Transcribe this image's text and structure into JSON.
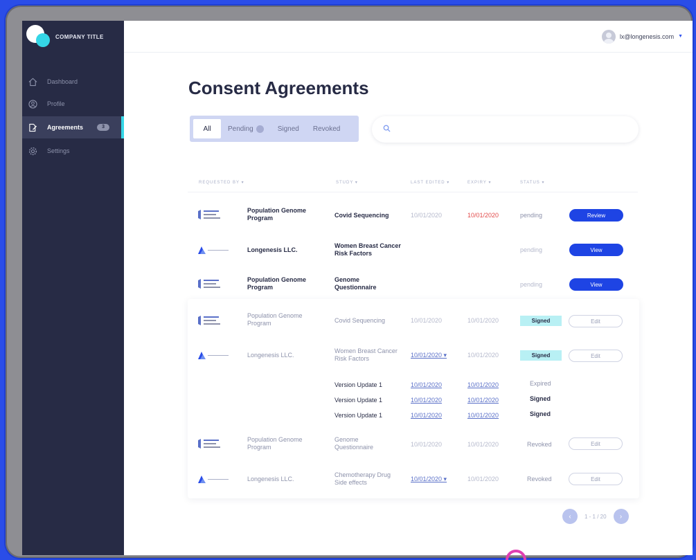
{
  "brand": {
    "title": "COMPANY TITLE"
  },
  "sidebar": {
    "items": [
      {
        "label": "Dashboard",
        "icon": "home-icon"
      },
      {
        "label": "Profile",
        "icon": "user-circle-icon"
      },
      {
        "label": "Agreements",
        "icon": "document-edit-icon",
        "badge": "3",
        "active": true
      },
      {
        "label": "Settings",
        "icon": "gear-icon"
      }
    ]
  },
  "topbar": {
    "user_email": "lx@longenesis.com"
  },
  "page": {
    "title": "Consent Agreements"
  },
  "filters": {
    "all": "All",
    "pending": "Pending",
    "signed": "Signed",
    "revoked": "Revoked"
  },
  "search": {
    "placeholder": ""
  },
  "table": {
    "headers": {
      "requested_by": "REQUESTED BY ▾",
      "study": "STUDY ▾",
      "last_edited": "LAST EDITED ▾",
      "expiry": "EXPIRY ▾",
      "status": "STATUS ▾"
    },
    "rows": [
      {
        "requester": "Population Genome Program",
        "study": "Covid Sequencing",
        "last_edited": "10/01/2020",
        "expiry": "10/01/2020",
        "status": "pending",
        "action": "Review"
      },
      {
        "requester": "Longenesis LLC.",
        "study": "Women Breast Cancer Risk Factors",
        "last_edited": "",
        "expiry": "",
        "status": "pending",
        "action": "View"
      },
      {
        "requester": "Population Genome Program",
        "study": "Genome Questionnaire",
        "last_edited": "",
        "expiry": "",
        "status": "pending",
        "action": "View"
      },
      {
        "requester": "Population Genome Program",
        "study": "Covid Sequencing",
        "last_edited": "10/01/2020",
        "expiry": "10/01/2020",
        "status": "Signed",
        "action": "Edit"
      },
      {
        "requester": "Longenesis LLC.",
        "study": "Women Breast Cancer Risk Factors",
        "last_edited": "10/01/2020 ▾",
        "expiry": "10/01/2020",
        "status": "Signed",
        "action": "Edit"
      },
      {
        "requester": "Population Genome Program",
        "study": "Genome Questionnaire",
        "last_edited": "10/01/2020",
        "expiry": "10/01/2020",
        "status": "Revoked",
        "action": "Edit"
      },
      {
        "requester": "Longenesis LLC.",
        "study": "Chemotherapy Drug Side effects",
        "last_edited": "10/01/2020 ▾",
        "expiry": "10/01/2020",
        "status": "Revoked",
        "action": "Edit"
      }
    ],
    "versions": [
      {
        "label": "Version Update 1",
        "last_edited": "10/01/2020",
        "expiry": "10/01/2020",
        "status": "Expired"
      },
      {
        "label": "Version Update 1",
        "last_edited": "10/01/2020",
        "expiry": "10/01/2020",
        "status": "Signed"
      },
      {
        "label": "Version Update 1",
        "last_edited": "10/01/2020",
        "expiry": "10/01/2020",
        "status": "Signed"
      }
    ]
  },
  "pagination": {
    "text": "1 - 1 / 20"
  },
  "colors": {
    "sidebar": "#272b45",
    "accent": "#35d6e6",
    "primary": "#1e44e4",
    "signed_badge": "#b8f0f4",
    "expiry_red": "#e24a4a"
  }
}
